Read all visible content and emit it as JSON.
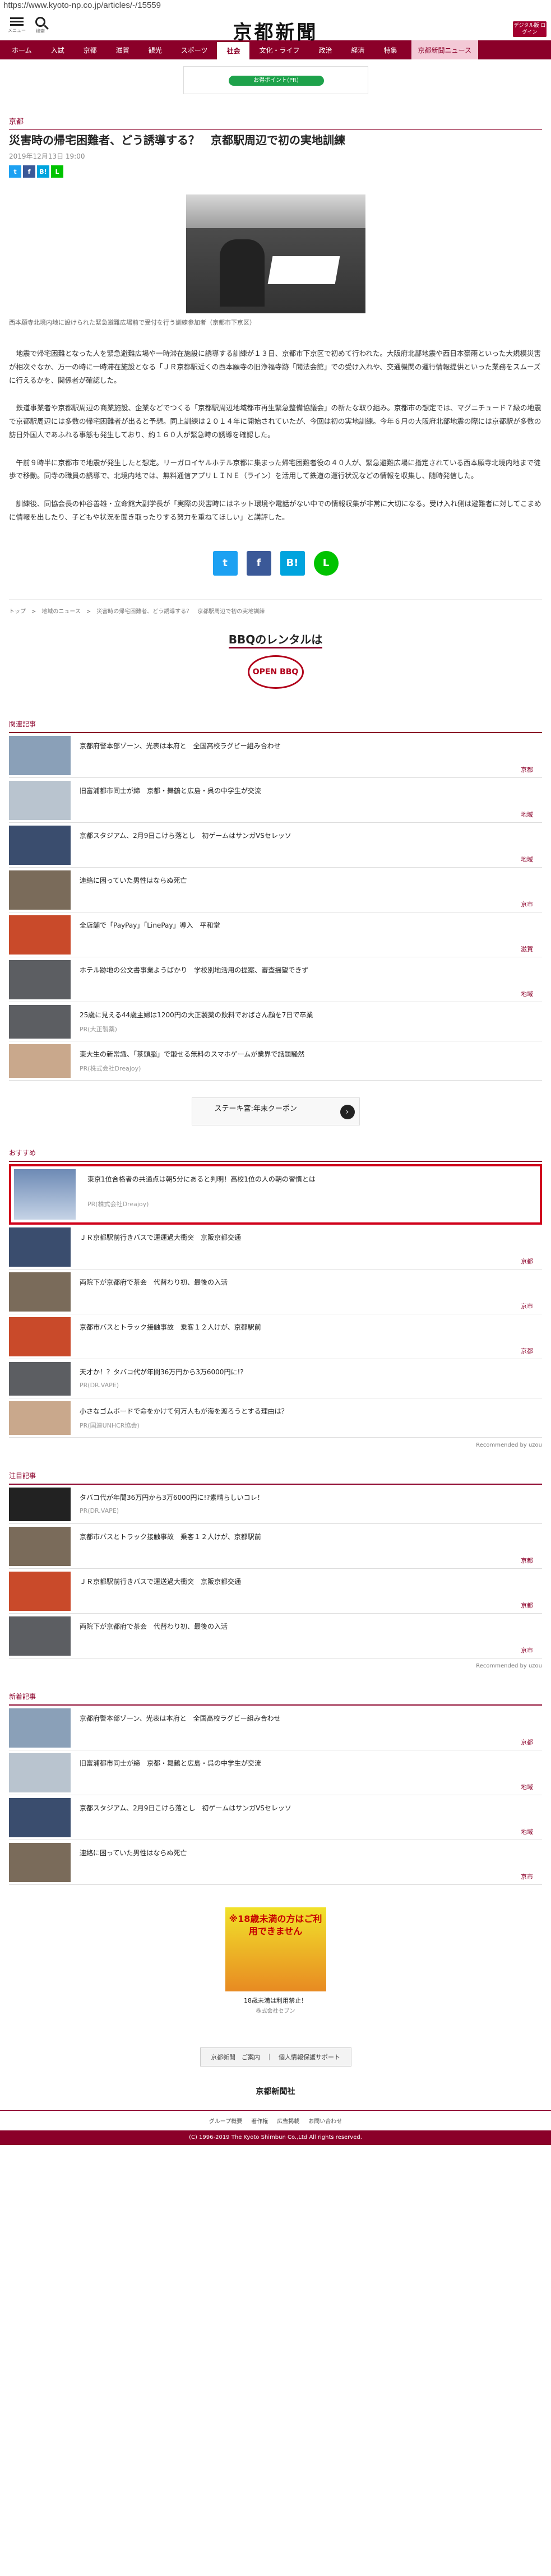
{
  "url": "https://www.kyoto-np.co.jp/articles/-/15559",
  "header": {
    "menu_label": "メニュー",
    "search_label": "検索",
    "logo": "京都新聞",
    "edition_button": "デジタル版\nログイン"
  },
  "nav": [
    "ホーム",
    "入試",
    "京都",
    "滋賀",
    "観光",
    "スポーツ",
    "社会",
    "文化・ライフ",
    "政治",
    "経済",
    "特集",
    "京都新聞ニュース"
  ],
  "nav_active": "社会",
  "top_ad": {
    "text": "お得ポイント(PR)"
  },
  "article": {
    "section": "京都",
    "headline": "災害時の帰宅困難者、どう誘導する？　京都駅周辺で初の実地訓練",
    "date": "2019年12月13日 19:00",
    "caption": "西本願寺北境内地に設けられた緊急避難広場前で受付を行う訓練参加者（京都市下京区）",
    "paragraphs": [
      "地震で帰宅困難となった人を緊急避難広場や一時滞在施設に誘導する訓練が１３日、京都市下京区で初めて行われた。大阪府北部地震や西日本豪雨といった大規模災害が相次ぐなか、万一の時に一時滞在施設となる「ＪＲ京都駅近くの西本願寺の旧浄福寺跡「聞法会館」での受け入れや、交通機関の運行情報提供といった業務をスムーズに行えるかを、関係者が確認した。",
      "鉄道事業者や京都駅周辺の商業施設、企業などでつくる「京都駅周辺地域都市再生緊急整備協議会」の新たな取り組み。京都市の想定では、マグニチュード７級の地震で京都駅周辺には多数の帰宅困難者が出ると予想。同上訓練は２０１４年に開始されていたが、今回は初の実地訓練。今年６月の大阪府北部地震の際には京都駅が多数の訪日外国人であふれる事態も発生しており、約１６０人が緊急時の誘導を確認した。",
      "午前９時半に京都市で地震が発生したと想定。リーガロイヤルホテル京都に集まった帰宅困難者役の４０人が、緊急避難広場に指定されている西本願寺北境内地まで徒歩で移動。同寺の職員の誘導で、北境内地では、無料通信アプリＬＩＮＥ（ライン）を活用して鉄道の運行状況などの情報を収集し、随時発信した。",
      "訓練後、同協会長の仲谷善雄・立命館大副学長が「実際の災害時にはネット環境や電話がない中での情報収集が非常に大切になる。受け入れ側は避難者に対してこまめに情報を出したり、子どもや状況を聞き取ったりする努力を重ねてほしい」と講評した。"
    ],
    "breadcrumb": "トップ　>　地域のニュース　>　災害時の帰宅困難者、どう誘導する？　京都駅周辺で初の実地訓練"
  },
  "ad_bbq": {
    "title": "BBQのレンタルは",
    "logo": "OPEN BBQ"
  },
  "related": {
    "title": "関連記事",
    "items": [
      {
        "title": "京都府警本部ゾーン、光表は本府と　全国高校ラグビー組み合わせ",
        "tag": "京都"
      },
      {
        "title": "旧富浦都市同士が締　京都・舞鶴と広島・呉の中学生が交流",
        "tag": "地域"
      },
      {
        "title": "京都スタジアム、2月9日こけら落とし　初ゲームはサンガVSセレッソ",
        "tag": "地域"
      },
      {
        "title": "連絡に困っていた男性はならぬ死亡",
        "tag": "京市"
      },
      {
        "title": "全店舗で「PayPay」「LinePay」導入　平和堂",
        "tag": "滋賀"
      },
      {
        "title": "ホテル跡地の公文書事業ようばかり　学校別地活用の提案、審査揺望できず",
        "tag": "地域"
      }
    ],
    "pr": [
      {
        "title": "25歳に見える44歳主婦は1200円の大正製薬の飲料でおばさん顔を7日で卒業",
        "src": "PR(大正製薬)"
      },
      {
        "title": "東大生の新常識、「茶頭脳」で鍛せる無料のスマホゲームが業界で話題騒然",
        "src": "PR(株式会社Dreajoy)"
      }
    ]
  },
  "inline_ad": {
    "text": "ステーキ宮:年末クーポン"
  },
  "recommend": {
    "title": "おすすめ",
    "highlight": {
      "title": "東京1位合格者の共通点は朝5分にあると判明！高校1位の人の朝の習慣とは",
      "src": "PR(株式会社Dreajoy)"
    },
    "items": [
      {
        "title": "ＪＲ京都駅前行きバスで運運過大衝突　京阪京都交通",
        "tag": "京都"
      },
      {
        "title": "両院下が京都府で茶会　代替わり初、最後の入活",
        "tag": "京市"
      },
      {
        "title": "京都市バスとトラック接触事故　乗客１２人けが、京都駅前",
        "tag": "京都"
      }
    ],
    "pr": [
      {
        "title": "天才か！？タバコ代が年間36万円から3万6000円に!?",
        "src": "PR(DR.VAPE)"
      },
      {
        "title": "小さなゴムボードで命をかけて何万人もが海を渡ろうとする理由は？",
        "src": "PR(国連UNHCR協会)"
      }
    ],
    "source": "Recommended by uzou"
  },
  "attention": {
    "title": "注目記事",
    "pr": {
      "title": "タバコ代が年間36万円から3万6000円に!?素晴らしいコレ！",
      "src": "PR(DR.VAPE)"
    },
    "items": [
      {
        "title": "京都市バスとトラック接触事故　乗客１２人けが、京都駅前",
        "tag": "京都"
      },
      {
        "title": "ＪＲ京都駅前行きバスで運送過大衝突　京阪京都交通",
        "tag": "京都"
      },
      {
        "title": "両院下が京都府で茶会　代替わり初、最後の入活",
        "tag": "京市"
      }
    ],
    "source": "Recommended by uzou"
  },
  "latest": {
    "title": "新着記事",
    "items": [
      {
        "title": "京都府警本部ゾーン、光表は本府と　全国高校ラグビー組み合わせ",
        "tag": "京都"
      },
      {
        "title": "旧富浦都市同士が締　京都・舞鶴と広島・呉の中学生が交流",
        "tag": "地域"
      },
      {
        "title": "京都スタジアム、2月9日こけら落とし　初ゲームはサンガVSセレッソ",
        "tag": "地域"
      },
      {
        "title": "連絡に困っていた男性はならぬ死亡",
        "tag": "京市"
      }
    ]
  },
  "footer_ad": {
    "text": "※18歳未満の方はご利用できません",
    "sub": "18歳未満は利用禁止！",
    "src": "株式会社セブン"
  },
  "footer": {
    "links": "京都新聞　ご案内　｜　個人情報保護サポート",
    "logo": "京都新聞社",
    "bottom_links": [
      "グループ概要",
      "著作権",
      "広告掲載",
      "お問い合わせ"
    ],
    "copyright": "(C) 1996-2019 The Kyoto Shimbun Co.,Ltd All rights reserved."
  }
}
